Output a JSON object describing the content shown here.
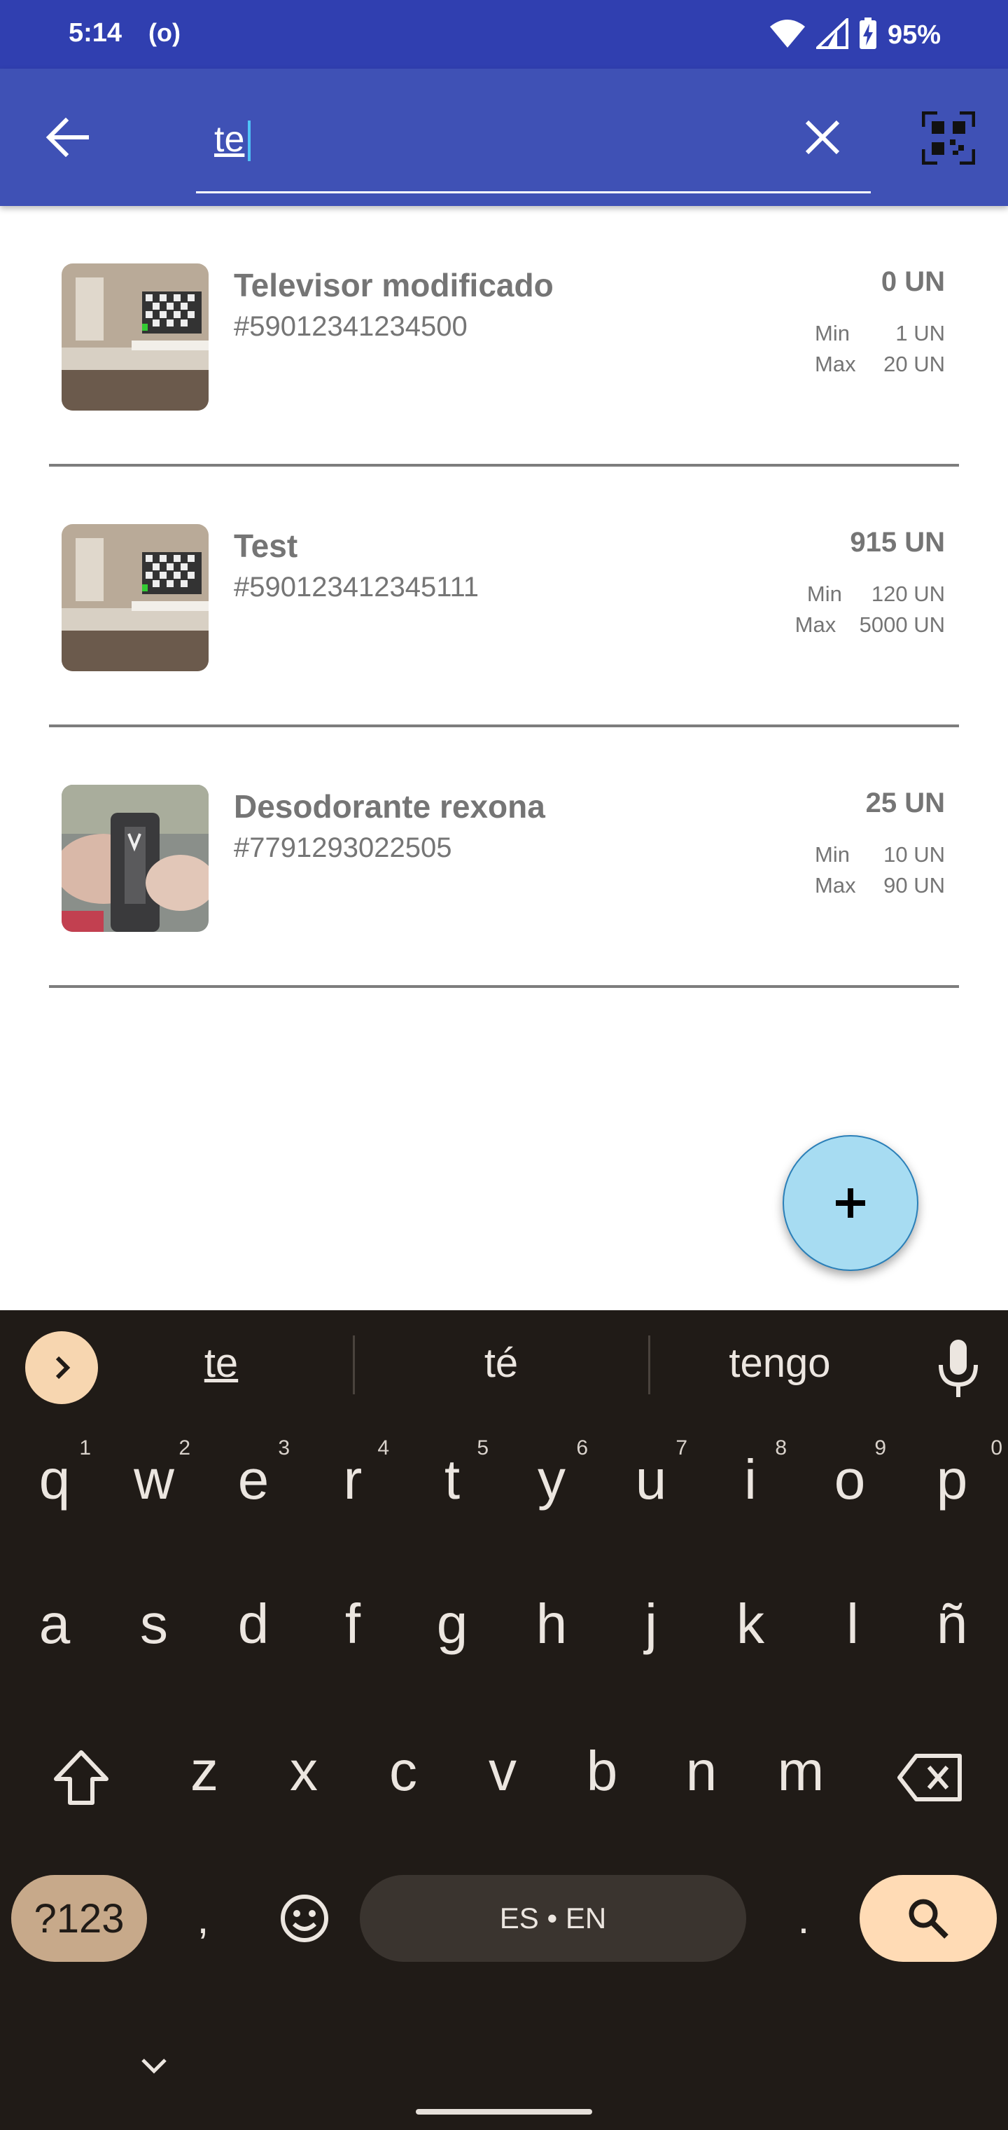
{
  "status_bar": {
    "time": "5:14",
    "radio": "(o)",
    "battery": "95%"
  },
  "app_bar": {
    "search_value": "te",
    "colors": {
      "primary": "#3f51b5",
      "status": "#303fb0"
    }
  },
  "products": [
    {
      "name": "Televisor modificado",
      "code": "#59012341234500",
      "qty": "0 UN",
      "min_label": "Min",
      "min": "1 UN",
      "max_label": "Max",
      "max": "20 UN",
      "thumb_icon": "tv-room-photo"
    },
    {
      "name": "Test",
      "code": "#590123412345111",
      "qty": "915 UN",
      "min_label": "Min",
      "min": "120 UN",
      "max_label": "Max",
      "max": "5000 UN",
      "thumb_icon": "tv-room-photo"
    },
    {
      "name": "Desodorante rexona",
      "code": "#7791293022505",
      "qty": "25 UN",
      "min_label": "Min",
      "min": "10 UN",
      "max_label": "Max",
      "max": "90 UN",
      "thumb_icon": "deodorant-photo"
    }
  ],
  "fab": {
    "icon": "plus-icon",
    "color": "#a7dcf2"
  },
  "keyboard": {
    "suggestions": [
      "te",
      "té",
      "tengo"
    ],
    "row1": [
      {
        "k": "q",
        "h": "1"
      },
      {
        "k": "w",
        "h": "2"
      },
      {
        "k": "e",
        "h": "3"
      },
      {
        "k": "r",
        "h": "4"
      },
      {
        "k": "t",
        "h": "5"
      },
      {
        "k": "y",
        "h": "6"
      },
      {
        "k": "u",
        "h": "7"
      },
      {
        "k": "i",
        "h": "8"
      },
      {
        "k": "o",
        "h": "9"
      },
      {
        "k": "p",
        "h": "0"
      }
    ],
    "row2": [
      "a",
      "s",
      "d",
      "f",
      "g",
      "h",
      "j",
      "k",
      "l",
      "ñ"
    ],
    "row3": [
      "z",
      "x",
      "c",
      "v",
      "b",
      "n",
      "m"
    ],
    "symbols_label": "?123",
    "comma": ",",
    "space_label": "ES • EN",
    "period": ".",
    "colors": {
      "background": "#201b17",
      "accent": "#ffdbb5"
    }
  }
}
